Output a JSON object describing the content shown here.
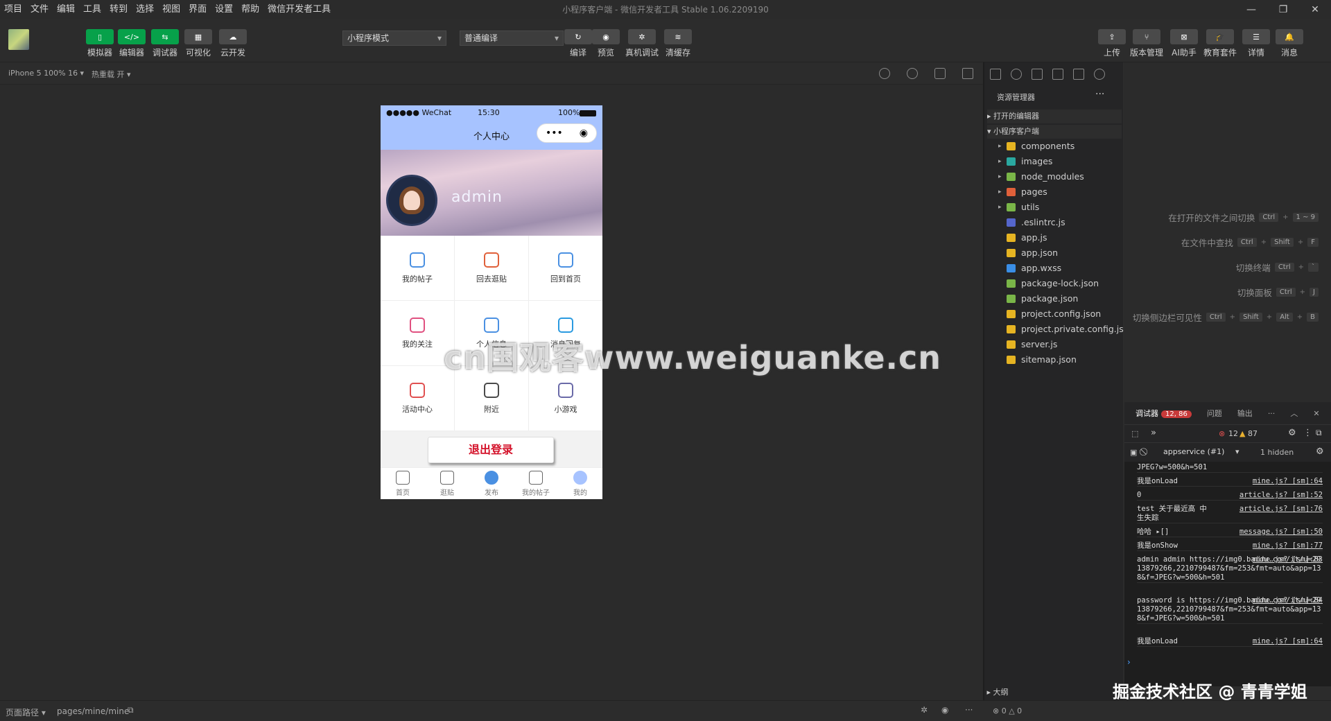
{
  "menu": [
    "项目",
    "文件",
    "编辑",
    "工具",
    "转到",
    "选择",
    "视图",
    "界面",
    "设置",
    "帮助",
    "微信开发者工具"
  ],
  "window_title": "小程序客户端 - 微信开发者工具 Stable 1.06.2209190",
  "window_controls": {
    "min": "—",
    "max": "❐",
    "close": "✕"
  },
  "toolbar": {
    "left_buttons": [
      "模拟器",
      "编辑器",
      "调试器",
      "可视化",
      "云开发"
    ],
    "mode_select": "小程序模式",
    "compile_select": "普通编译",
    "mid_buttons": [
      "编译",
      "预览",
      "真机调试",
      "清缓存"
    ],
    "right_buttons": [
      "上传",
      "版本管理",
      "AI助手",
      "教育套件",
      "详情",
      "消息"
    ]
  },
  "subbar": {
    "device": "iPhone 5 100% 16 ▾",
    "hotreload": "热重载 开 ▾"
  },
  "phone": {
    "status_signal": "●●●●● WeChat",
    "status_time": "15:30",
    "status_battery": "100%",
    "nav_title": "个人中心",
    "username": "admin",
    "grid": [
      "我的帖子",
      "回去逛贴",
      "回到首页",
      "我的关注",
      "个人信息",
      "消息回复",
      "活动中心",
      "附近",
      "小游戏"
    ],
    "logout": "退出登录",
    "tabs": [
      "首页",
      "逛贴",
      "发布",
      "我的帖子",
      "我的"
    ]
  },
  "watermark": "cn国观客www.weiguanke.cn",
  "explorer": {
    "title": "资源管理器",
    "more": "···",
    "open_editors": "打开的编辑器",
    "project": "小程序客户端",
    "folders": [
      "components",
      "images",
      "node_modules",
      "pages",
      "utils"
    ],
    "files": [
      ".eslintrc.js",
      "app.js",
      "app.json",
      "app.wxss",
      "package-lock.json",
      "package.json",
      "project.config.json",
      "project.private.config.js...",
      "server.js",
      "sitemap.json"
    ],
    "outline": "大纲",
    "colors": {
      "components": "#e6b422",
      "images": "#2aa8a0",
      "node_modules": "#7ab648",
      "pages": "#e0603a",
      "utils": "#7ab648"
    }
  },
  "shortcuts": [
    {
      "label": "在打开的文件之间切换",
      "keys": [
        "Ctrl",
        "1 ~ 9"
      ]
    },
    {
      "label": "在文件中查找",
      "keys": [
        "Ctrl",
        "Shift",
        "F"
      ]
    },
    {
      "label": "切换终端",
      "keys": [
        "Ctrl",
        "`"
      ]
    },
    {
      "label": "切换面板",
      "keys": [
        "Ctrl",
        "J"
      ]
    },
    {
      "label": "切换侧边栏可见性",
      "keys": [
        "Ctrl",
        "Shift",
        "Alt",
        "B"
      ]
    }
  ],
  "debugger": {
    "tabs": [
      "调试器",
      "问题",
      "输出"
    ],
    "badge": "12, 86",
    "errors": "12",
    "warnings": "87",
    "context": "appservice (#1)",
    "hidden": "1 hidden",
    "logs": [
      {
        "text": "JPEG?w=500&h=501",
        "src": ""
      },
      {
        "text": "我是onLoad",
        "src": "mine.js? [sm]:64"
      },
      {
        "text": "0",
        "src": "article.js? [sm]:52"
      },
      {
        "text": "test 关于最近高 中生失踪",
        "src": "article.js? [sm]:76"
      },
      {
        "text": "哈哈 ▸[]",
        "src": "message.js? [sm]:50"
      },
      {
        "text": "我是onShow",
        "src": "mine.js? [sm]:77"
      },
      {
        "text": "admin admin https://img0.baidu.com/it/u=2913879266,2210799487&fm=253&fmt=auto&app=138&f=JPEG?w=500&h=501",
        "src": "mine.js? [sm]:83"
      },
      {
        "text": "password is https://img0.baidu.com/it/u=2913879266,2210799487&fm=253&fmt=auto&app=138&f=JPEG?w=500&h=501",
        "src": "mine.js? [sm]:84"
      },
      {
        "text": "我是onLoad",
        "src": "mine.js? [sm]:64"
      }
    ]
  },
  "statusbar": {
    "path_label": "页面路径 ▾",
    "path": "pages/mine/mine",
    "errs": "⊗ 0 △ 0"
  },
  "juejin": "掘金技术社区 @ 青青学姐"
}
